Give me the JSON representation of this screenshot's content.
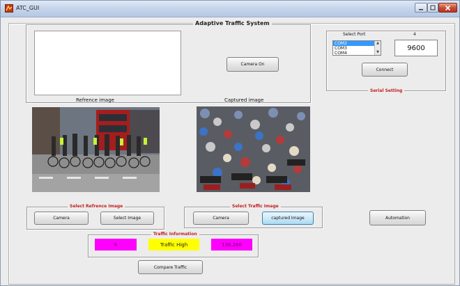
{
  "window": {
    "title": "ATC_GUI"
  },
  "main_panel": {
    "title": "Adaptive Traffic System"
  },
  "capture": {
    "reference_label": "Refrence image",
    "captured_label": "Captured image",
    "camera_on_label": "Camera On"
  },
  "serial": {
    "title": "Serial Setting",
    "select_port_label": "Select Port",
    "port_number": "4",
    "ports": [
      "COM2",
      "COM3",
      "COM4"
    ],
    "selected_port_index": 0,
    "baud_rate": "9600",
    "connect_label": "Connect"
  },
  "select_reference": {
    "title": "Select Refrence Image",
    "camera_label": "Camera",
    "select_image_label": "Select Image"
  },
  "select_traffic": {
    "title": "Select Traffic Image",
    "camera_label": "Camera",
    "captured_image_label": "captured Image"
  },
  "automation_label": "Automation",
  "traffic_info": {
    "title": "Traffic Information",
    "count_value": "6",
    "status_value": "Traffic High",
    "pixel_value": "136.266"
  },
  "compare_traffic_label": "Compare Traffic",
  "colors": {
    "magenta": "#ff00ff",
    "yellow": "#ffff00",
    "panel_title_red": "#c21f1f",
    "selection_blue": "#3399ff"
  }
}
